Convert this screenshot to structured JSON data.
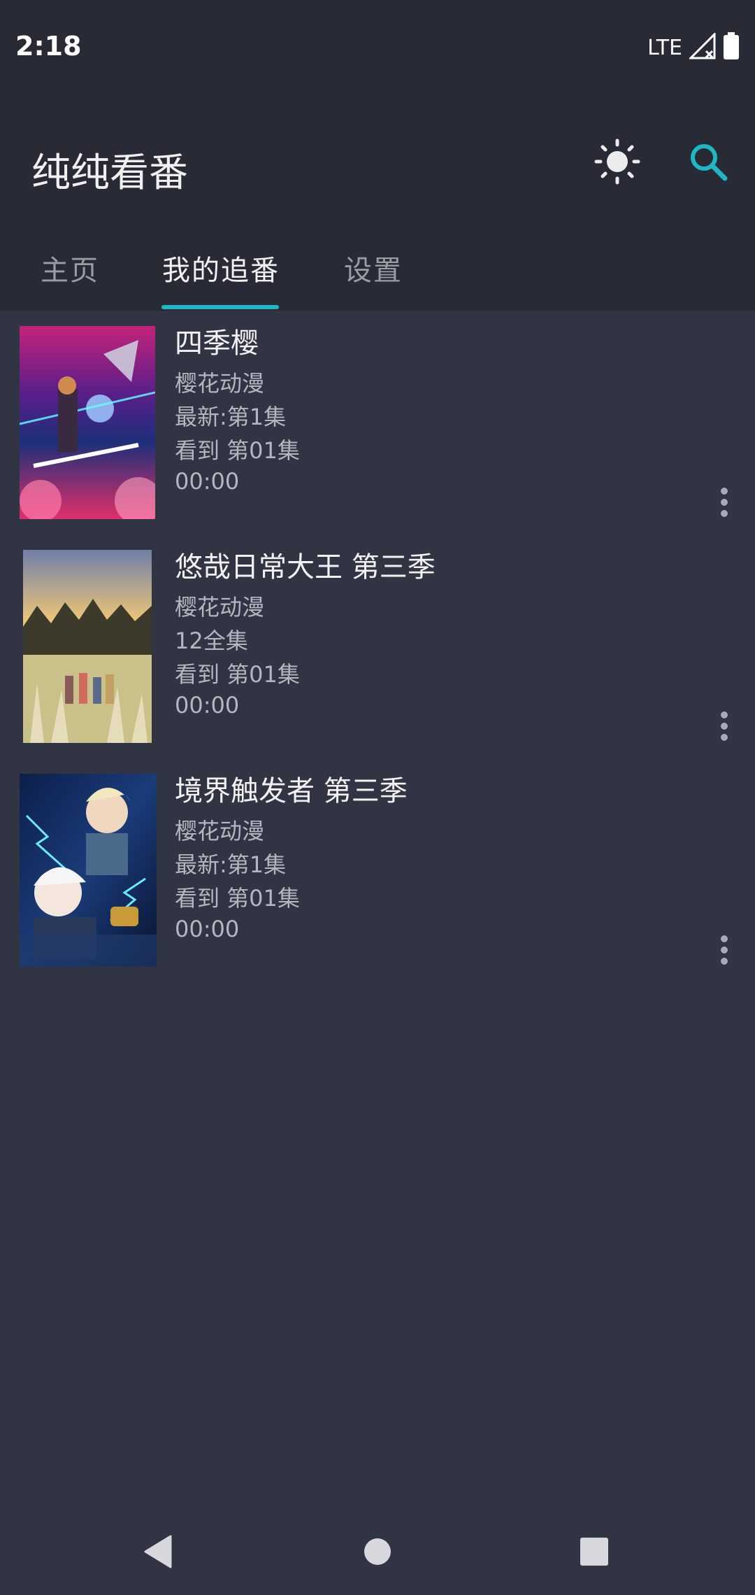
{
  "status_bar": {
    "time": "2:18",
    "network": "LTE"
  },
  "app": {
    "title": "纯纯看番"
  },
  "toolbar": {
    "theme_icon": "sun-icon",
    "search_icon": "search-icon",
    "accent": "#1fb7c4"
  },
  "tabs": [
    {
      "label": "主页",
      "active": false
    },
    {
      "label": "我的追番",
      "active": true
    },
    {
      "label": "设置",
      "active": false
    }
  ],
  "items": [
    {
      "title": "四季樱",
      "source": "樱花动漫",
      "latest": "最新:第1集",
      "progress": "看到 第01集",
      "time": "00:00"
    },
    {
      "title": "悠哉日常大王 第三季",
      "source": "樱花动漫",
      "latest": "12全集",
      "progress": "看到 第01集",
      "time": "00:00"
    },
    {
      "title": "境界触发者 第三季",
      "source": "樱花动漫",
      "latest": "最新:第1集",
      "progress": "看到 第01集",
      "time": "00:00"
    }
  ],
  "colors": {
    "background": "#313442",
    "header": "#282a36",
    "accent": "#1fb7c4"
  }
}
